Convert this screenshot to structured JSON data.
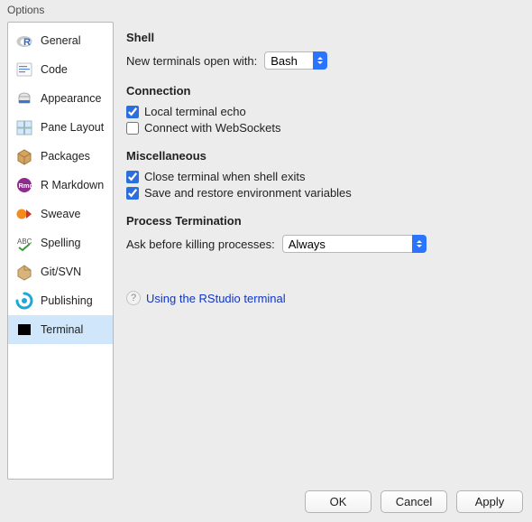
{
  "window_title": "Options",
  "sidebar": {
    "items": [
      {
        "label": "General"
      },
      {
        "label": "Code"
      },
      {
        "label": "Appearance"
      },
      {
        "label": "Pane Layout"
      },
      {
        "label": "Packages"
      },
      {
        "label": "R Markdown"
      },
      {
        "label": "Sweave"
      },
      {
        "label": "Spelling"
      },
      {
        "label": "Git/SVN"
      },
      {
        "label": "Publishing"
      },
      {
        "label": "Terminal"
      }
    ],
    "selected_index": 10
  },
  "sections": {
    "shell": {
      "title": "Shell",
      "open_with_label": "New terminals open with:",
      "open_with_value": "Bash"
    },
    "connection": {
      "title": "Connection",
      "local_echo": {
        "label": "Local terminal echo",
        "checked": true
      },
      "websockets": {
        "label": "Connect with WebSockets",
        "checked": false
      }
    },
    "misc": {
      "title": "Miscellaneous",
      "close_on_exit": {
        "label": "Close terminal when shell exits",
        "checked": true
      },
      "save_env": {
        "label": "Save and restore environment variables",
        "checked": true
      }
    },
    "termination": {
      "title": "Process Termination",
      "ask_label": "Ask before killing processes:",
      "ask_value": "Always"
    }
  },
  "help_link": "Using the RStudio terminal",
  "buttons": {
    "ok": "OK",
    "cancel": "Cancel",
    "apply": "Apply"
  }
}
